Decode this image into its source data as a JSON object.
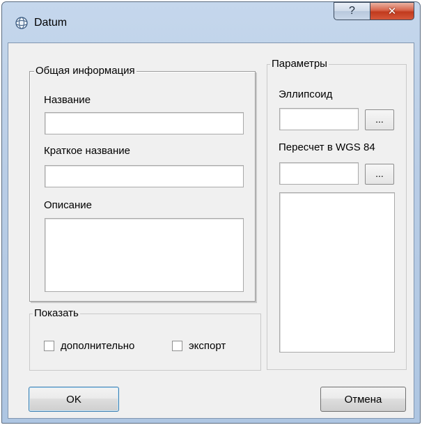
{
  "window": {
    "title": "Datum",
    "help_glyph": "?",
    "close_glyph": "✕"
  },
  "general_group": {
    "legend": "Общая информация",
    "name_label": "Название",
    "name_value": "",
    "short_name_label": "Краткое название",
    "short_name_value": "",
    "description_label": "Описание",
    "description_value": ""
  },
  "params_group": {
    "legend": "Параметры",
    "ellipsoid_label": "Эллипсоид",
    "ellipsoid_value": "",
    "ellipsoid_browse": "...",
    "wgs84_label": "Пересчет в WGS 84",
    "wgs84_value": "",
    "wgs84_browse": "..."
  },
  "show_group": {
    "legend": "Показать",
    "advanced_label": "дополнительно",
    "advanced_checked": false,
    "export_label": "экспорт",
    "export_checked": false
  },
  "buttons": {
    "ok": "OK",
    "cancel": "Отмена"
  },
  "colors": {
    "titlebar": "#b9cde6",
    "client_bg": "#f0f0f0",
    "close_button": "#c13a1e"
  }
}
